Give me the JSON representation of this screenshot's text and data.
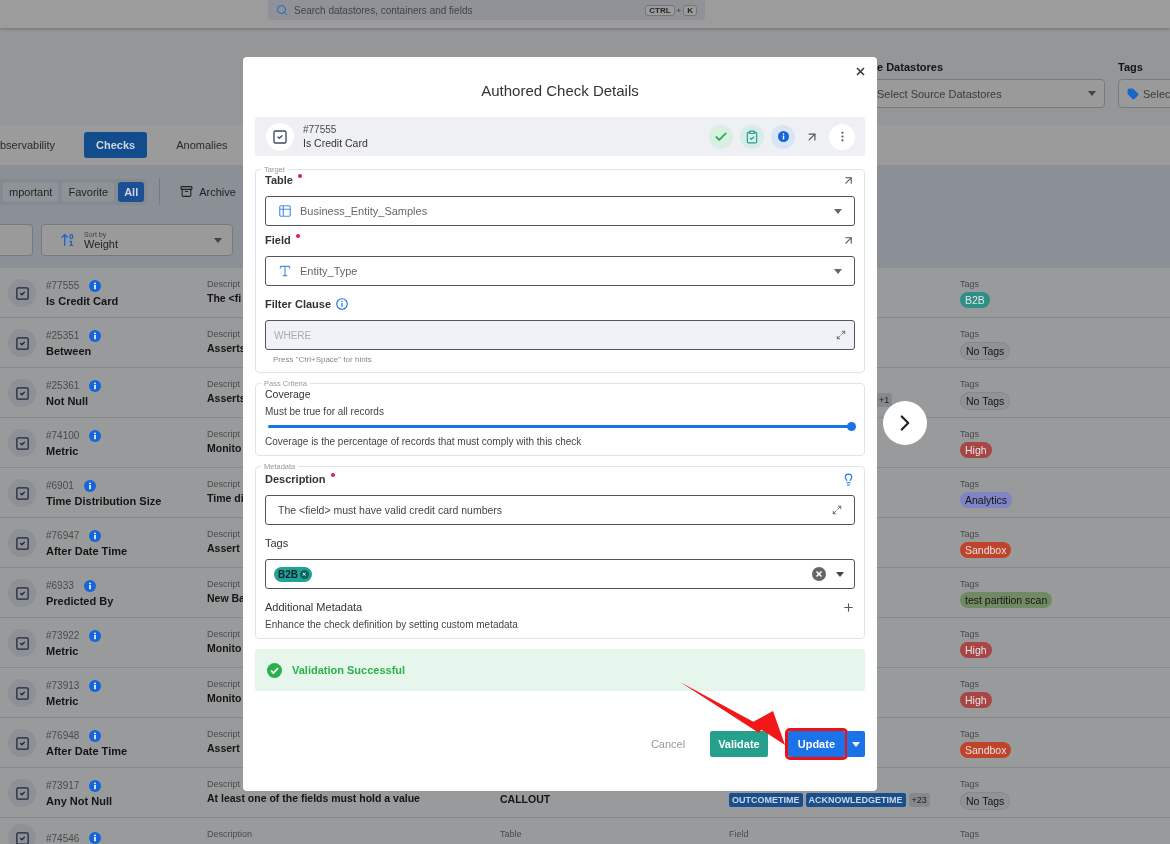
{
  "top_bar": {
    "search": {
      "placeholder": "Search datastores, containers and fields",
      "keys": [
        "CTRL",
        "+",
        "K"
      ]
    }
  },
  "filters": [
    {
      "label": "e Datastores",
      "placeholder": "Select Source Datastores",
      "kind": "select"
    },
    {
      "label": "Tags",
      "placeholder": "Selec",
      "kind": "tags"
    }
  ],
  "tabs": [
    {
      "label": "bservability",
      "selected": false
    },
    {
      "label": "Checks",
      "selected": true
    },
    {
      "label": "Anomalies",
      "selected": false
    }
  ],
  "chips": [
    {
      "label": "mportant",
      "selected": false
    },
    {
      "label": "Favorite",
      "selected": false
    },
    {
      "label": "All",
      "selected": true
    }
  ],
  "archive": {
    "label": "Archive"
  },
  "sort": {
    "caption": "Sort by",
    "value": "Weight"
  },
  "rows": [
    {
      "id": "#77555",
      "name": "Is Credit Card",
      "description_label": "Descript",
      "description": "The <fi",
      "tags_label": "Tags",
      "tags": [
        {
          "label": "B2B",
          "color": "#2e8f86"
        }
      ]
    },
    {
      "id": "#25351",
      "name": "Between",
      "description_label": "Descript",
      "description": "Asserts",
      "tags_label": "Tags",
      "tags": [
        {
          "label": "No Tags",
          "color": "#8f9396"
        }
      ]
    },
    {
      "id": "#25361",
      "name": "Not Null",
      "description_label": "Descript",
      "description": "Asserts",
      "field_more": "+1",
      "tags_label": "Tags",
      "tags": [
        {
          "label": "No Tags",
          "color": "#8f9396"
        }
      ]
    },
    {
      "id": "#74100",
      "name": "Metric",
      "description_label": "Descript",
      "description": "Monito",
      "tags_label": "Tags",
      "tags": [
        {
          "label": "High",
          "color": "#a84545"
        }
      ]
    },
    {
      "id": "#6901",
      "name": "Time Distribution Size",
      "description_label": "Descript",
      "description": "Time di",
      "tags_label": "Tags",
      "tags": [
        {
          "label": "Analytics",
          "color": "#7f84c4"
        }
      ]
    },
    {
      "id": "#76947",
      "name": "After Date Time",
      "description_label": "Descript",
      "description": "Assert",
      "tags_label": "Tags",
      "tags": [
        {
          "label": "Sandbox",
          "color": "#c0432c"
        }
      ]
    },
    {
      "id": "#6933",
      "name": "Predicted By",
      "description_label": "Descript",
      "description": "New Ba",
      "tags_label": "Tags",
      "tags": [
        {
          "label": "test partition scan",
          "color": "#728a64"
        }
      ]
    },
    {
      "id": "#73922",
      "name": "Metric",
      "description_label": "Descript",
      "description": "Monito",
      "tags_label": "Tags",
      "tags": [
        {
          "label": "High",
          "color": "#a84545"
        }
      ]
    },
    {
      "id": "#73913",
      "name": "Metric",
      "description_label": "Descript",
      "description": "Monito",
      "tags_label": "Tags",
      "tags": [
        {
          "label": "High",
          "color": "#a84545"
        }
      ]
    },
    {
      "id": "#76948",
      "name": "After Date Time",
      "description_label": "Descript",
      "description": "Assert",
      "tags_label": "Tags",
      "tags": [
        {
          "label": "Sandbox",
          "color": "#c0432c"
        }
      ]
    },
    {
      "id": "#73917",
      "name": "Any Not Null",
      "description_label": "Descript",
      "description": "At least one of the fields must hold a value",
      "table": "CALLOUT",
      "fields": [
        "OUTCOMETIME",
        "ACKNOWLEDGETIME"
      ],
      "field_more": "+23",
      "tags_label": "Tags",
      "tags": [
        {
          "label": "No Tags",
          "color": "#8f9396"
        }
      ]
    },
    {
      "id": "#74546",
      "description_label": "Description",
      "table_label": "Table",
      "field_label": "Field",
      "tags_label": "Tags"
    }
  ],
  "modal": {
    "title": "Authored Check Details",
    "check": {
      "id": "#77555",
      "name": "Is Credit Card"
    },
    "target": {
      "legend": "Target",
      "table": {
        "label": "Table",
        "required": true,
        "value": "Business_Entity_Samples"
      },
      "field": {
        "label": "Field",
        "required": true,
        "value": "Entity_Type"
      },
      "filter": {
        "label": "Filter Clause",
        "placeholder": "WHERE",
        "hint": "Press \"Ctrl+Space\" for hints"
      }
    },
    "pass_criteria": {
      "legend": "Pass Criteria",
      "title": "Coverage",
      "reading": "Must be true for all records",
      "level": 1,
      "note": "Coverage is the percentage of records that must comply with this check"
    },
    "metadata": {
      "legend": "Metadata",
      "description": {
        "label": "Description",
        "required": true,
        "value": "The <field> must have valid credit card numbers"
      },
      "tags": {
        "label": "Tags",
        "chips": [
          {
            "label": "B2B",
            "color": "#1fa396"
          }
        ]
      },
      "additional": {
        "title": "Additional Metadata",
        "note": "Enhance the check definition by setting custom metadata"
      }
    },
    "alert": {
      "kind": "success",
      "text": "Validation Successful"
    },
    "buttons": [
      {
        "label": "Cancel",
        "kind": "text",
        "highlighted": false
      },
      {
        "label": "Validate",
        "kind": "secondary",
        "highlighted": false
      },
      {
        "label": "Update",
        "kind": "primary",
        "highlighted": true
      }
    ]
  }
}
